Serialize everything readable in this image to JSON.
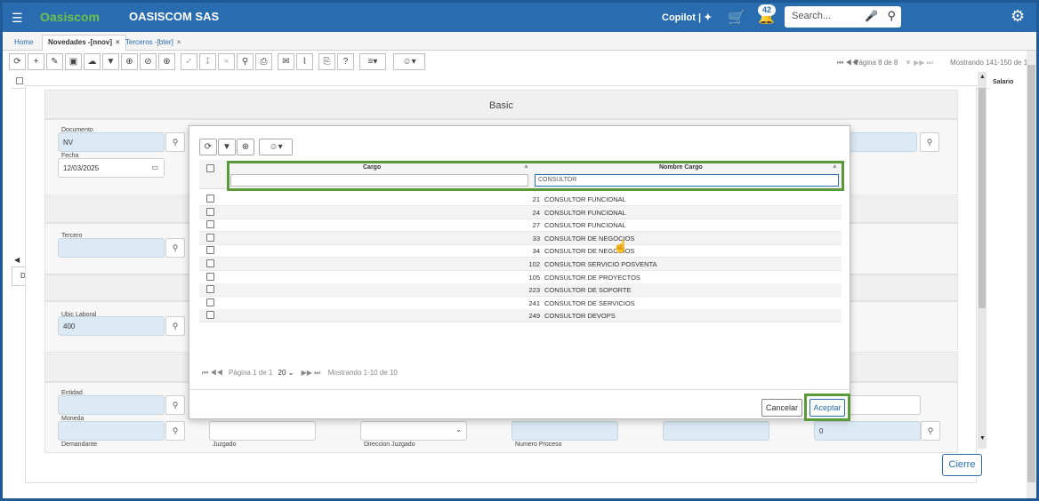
{
  "topbar": {
    "logo": "Oasiscom",
    "company": "OASISCOM SAS",
    "copilot": "Copilot",
    "notifications": "42",
    "search_placeholder": "Search..."
  },
  "tabs": [
    {
      "label": "Home"
    },
    {
      "label": "Novedades -[nnov]"
    },
    {
      "label": "Terceros -[bter]"
    }
  ],
  "toolbar": {
    "page_info": "Página 8 de 8",
    "showing": "Mostrando 141-150 de 1"
  },
  "background": {
    "salario_header": "Salario",
    "section_basic": "Basic",
    "documento_label": "Documento",
    "documento_value": "NV",
    "fecha_label": "Fecha",
    "fecha_value": "12/03/2025",
    "tercero_label": "Tercero",
    "ubic_label": "Ubic Laboral",
    "ubic_value": "400",
    "entidad_label": "Entidad",
    "moneda_label": "Moneda",
    "demandante_label": "Demandante",
    "juzgado_label": "Juzgado",
    "direccion_label": "Direccion Juzgado",
    "proceso_label": "Numero Proceso",
    "right_value": "0",
    "left_tab": "D",
    "cierre": "Cierre"
  },
  "modal": {
    "columns": {
      "cargo": "Cargo",
      "nombre": "Nombre Cargo"
    },
    "filters": {
      "cargo": "",
      "nombre": "CONSULTOR"
    },
    "rows": [
      {
        "cargo": "21",
        "nombre": "CONSULTOR FUNCIONAL"
      },
      {
        "cargo": "24",
        "nombre": "CONSULTOR FUNCIONAL"
      },
      {
        "cargo": "27",
        "nombre": "CONSULTOR FUNCIONAL"
      },
      {
        "cargo": "33",
        "nombre": "CONSULTOR DE NEGOCIOS"
      },
      {
        "cargo": "34",
        "nombre": "CONSULTOR DE NEGOCIOS"
      },
      {
        "cargo": "102",
        "nombre": "CONSULTOR SERVICIO POSVENTA"
      },
      {
        "cargo": "105",
        "nombre": "CONSULTOR DE PROYECTOS"
      },
      {
        "cargo": "223",
        "nombre": "CONSULTOR DE SOPORTE"
      },
      {
        "cargo": "241",
        "nombre": "CONSULTOR DE SERVICIOS"
      },
      {
        "cargo": "249",
        "nombre": "CONSULTOR DEVOPS"
      }
    ],
    "pager": {
      "page": "Página 1 de 1",
      "size": "20",
      "showing": "Mostrando 1-10 de 10"
    },
    "cancel": "Cancelar",
    "accept": "Aceptar"
  }
}
